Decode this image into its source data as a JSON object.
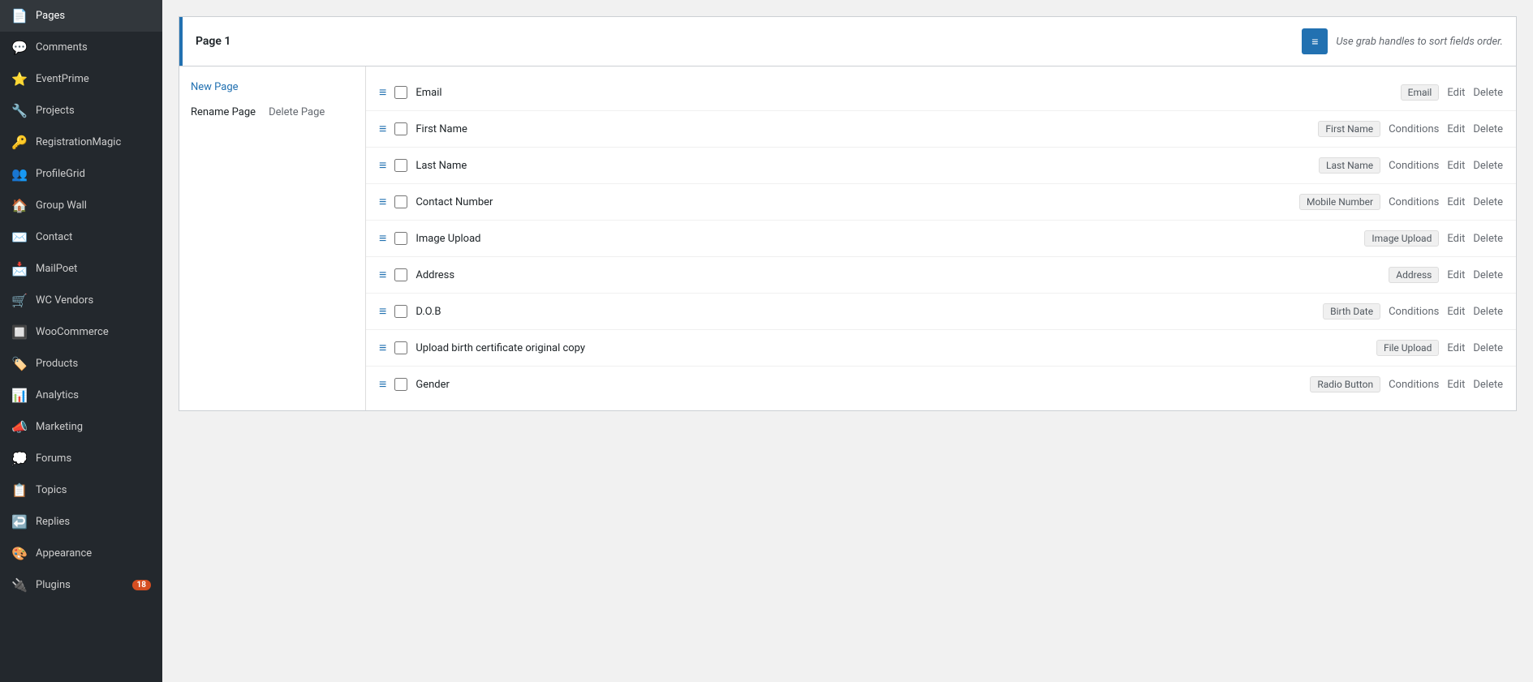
{
  "sidebar": {
    "items": [
      {
        "id": "pages",
        "label": "Pages",
        "icon": "📄",
        "badge": null
      },
      {
        "id": "comments",
        "label": "Comments",
        "icon": "💬",
        "badge": null
      },
      {
        "id": "eventprime",
        "label": "EventPrime",
        "icon": "⭐",
        "badge": null
      },
      {
        "id": "projects",
        "label": "Projects",
        "icon": "🔧",
        "badge": null
      },
      {
        "id": "registrationmagic",
        "label": "RegistrationMagic",
        "icon": "🔑",
        "badge": null
      },
      {
        "id": "profilegrid",
        "label": "ProfileGrid",
        "icon": "👥",
        "badge": null
      },
      {
        "id": "group-wall",
        "label": "Group Wall",
        "icon": "🏠",
        "badge": null
      },
      {
        "id": "contact",
        "label": "Contact",
        "icon": "✉️",
        "badge": null
      },
      {
        "id": "mailpoet",
        "label": "MailPoet",
        "icon": "📩",
        "badge": null
      },
      {
        "id": "wc-vendors",
        "label": "WC Vendors",
        "icon": "🛒",
        "badge": null
      },
      {
        "id": "woocommerce",
        "label": "WooCommerce",
        "icon": "🔲",
        "badge": null
      },
      {
        "id": "products",
        "label": "Products",
        "icon": "🏷️",
        "badge": null
      },
      {
        "id": "analytics",
        "label": "Analytics",
        "icon": "📊",
        "badge": null
      },
      {
        "id": "marketing",
        "label": "Marketing",
        "icon": "📣",
        "badge": null
      },
      {
        "id": "forums",
        "label": "Forums",
        "icon": "💭",
        "badge": null
      },
      {
        "id": "topics",
        "label": "Topics",
        "icon": "📋",
        "badge": null
      },
      {
        "id": "replies",
        "label": "Replies",
        "icon": "↩️",
        "badge": null
      },
      {
        "id": "appearance",
        "label": "Appearance",
        "icon": "🎨",
        "badge": null
      },
      {
        "id": "plugins",
        "label": "Plugins",
        "icon": "🔌",
        "badge": "18"
      }
    ]
  },
  "page_tab": {
    "title": "Page 1",
    "sort_hint": "Use grab handles to sort fields order.",
    "sort_icon": "≡"
  },
  "pages_panel": {
    "new_page_label": "New Page",
    "rename_label": "Rename Page",
    "delete_label": "Delete Page"
  },
  "fields": [
    {
      "id": "email",
      "label": "Email",
      "type_badge": "Email",
      "has_conditions": false,
      "actions": [
        "Edit",
        "Delete"
      ]
    },
    {
      "id": "first-name",
      "label": "First Name",
      "type_badge": "First Name",
      "has_conditions": true,
      "actions": [
        "Conditions",
        "Edit",
        "Delete"
      ]
    },
    {
      "id": "last-name",
      "label": "Last Name",
      "type_badge": "Last Name",
      "has_conditions": true,
      "actions": [
        "Conditions",
        "Edit",
        "Delete"
      ]
    },
    {
      "id": "contact-number",
      "label": "Contact Number",
      "type_badge": "Mobile Number",
      "has_conditions": true,
      "actions": [
        "Conditions",
        "Edit",
        "Delete"
      ]
    },
    {
      "id": "image-upload",
      "label": "Image Upload",
      "type_badge": "Image Upload",
      "has_conditions": false,
      "actions": [
        "Edit",
        "Delete"
      ]
    },
    {
      "id": "address",
      "label": "Address",
      "type_badge": "Address",
      "has_conditions": false,
      "actions": [
        "Edit",
        "Delete"
      ]
    },
    {
      "id": "dob",
      "label": "D.O.B",
      "type_badge": "Birth Date",
      "has_conditions": true,
      "actions": [
        "Conditions",
        "Edit",
        "Delete"
      ]
    },
    {
      "id": "birth-cert",
      "label": "Upload birth certificate original copy",
      "type_badge": "File Upload",
      "has_conditions": false,
      "actions": [
        "Edit",
        "Delete"
      ]
    },
    {
      "id": "gender",
      "label": "Gender",
      "type_badge": "Radio Button",
      "has_conditions": true,
      "actions": [
        "Conditions",
        "Edit",
        "Delete"
      ]
    }
  ],
  "colors": {
    "accent": "#2271b1",
    "sidebar_bg": "#23282d",
    "sidebar_text": "#cccccc"
  }
}
